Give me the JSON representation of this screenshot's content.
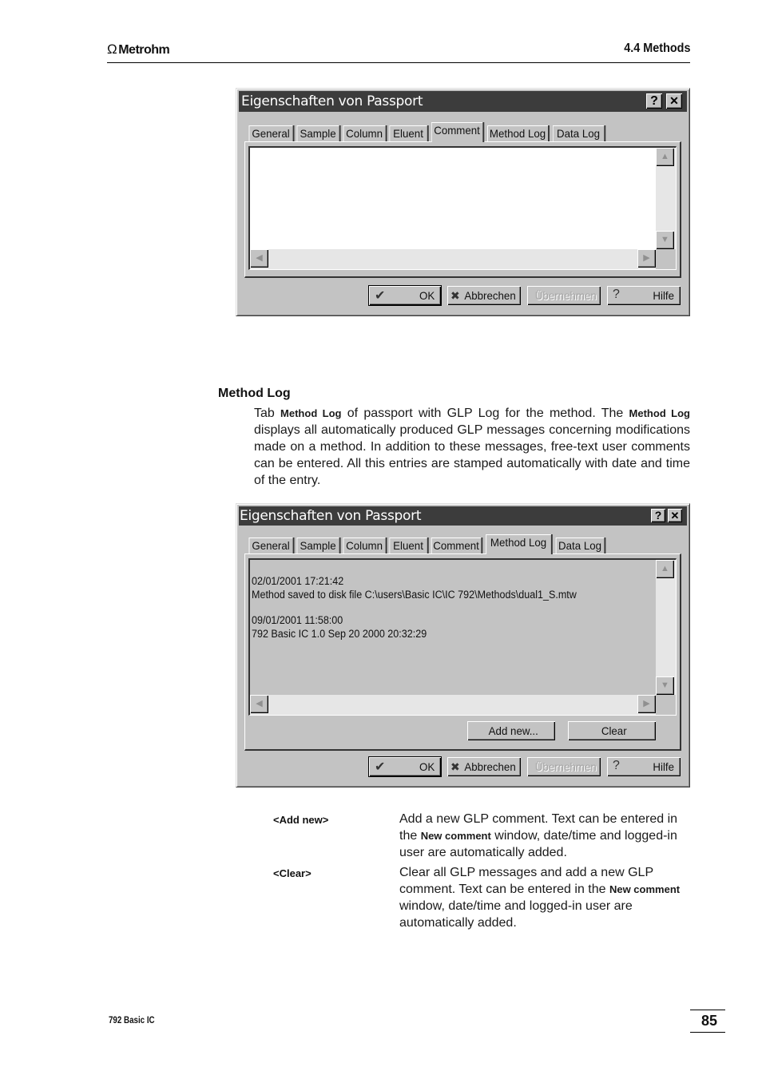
{
  "header": {
    "logo": "Metrohm",
    "logo_symbol": "Ω",
    "section": "4.4  Methods"
  },
  "dialog1": {
    "title": "Eigenschaften von Passport",
    "help_btn": "?",
    "close_btn": "✕",
    "active_tab": "Comment",
    "tabs": [
      "General",
      "Sample",
      "Column",
      "Eluent",
      "Comment",
      "Method Log",
      "Data Log"
    ],
    "comment_text": "",
    "buttons": {
      "ok": "OK",
      "cancel": "Abbrechen",
      "apply": "Übernehmen",
      "help": "Hilfe"
    },
    "icons": {
      "ok": "✔",
      "cancel": "✖",
      "help": "?"
    }
  },
  "method_log_section": {
    "heading": "Method Log",
    "para": [
      {
        "t": "Tab "
      },
      {
        "b": "Method Log"
      },
      {
        "t": " of passport with GLP Log for the method. The "
      },
      {
        "b": "Method Log"
      },
      {
        "t": " displays all automatically produced GLP messages concerning modifications made on a method. In addition to these messages, free-text user comments can be entered. All this entries are stamped automatically with date and time of the entry."
      }
    ]
  },
  "dialog2": {
    "title": "Eigenschaften von Passport",
    "help_btn": "?",
    "close_btn": "✕",
    "active_tab": "Method Log",
    "tabs": [
      "General",
      "Sample",
      "Column",
      "Eluent",
      "Comment",
      "Method Log",
      "Data Log"
    ],
    "log_entries": [
      {
        "timestamp": "02/01/2001 17:21:42",
        "message": "Method saved to disk file C:\\users\\Basic IC\\IC 792\\Methods\\dual1_S.mtw"
      },
      {
        "timestamp": "09/01/2001 11:58:00",
        "message": "792 Basic IC 1.0 Sep 20 2000 20:32:29"
      }
    ],
    "add_new": "Add new...",
    "clear": "Clear",
    "buttons": {
      "ok": "OK",
      "cancel": "Abbrechen",
      "apply": "Übernehmen",
      "help": "Hilfe"
    },
    "icons": {
      "ok": "✔",
      "cancel": "✖",
      "help": "?"
    }
  },
  "definitions": [
    {
      "label": "<Add new>",
      "desc": [
        {
          "t": "Add a new GLP comment. Text can be entered in the "
        },
        {
          "b": "New comment"
        },
        {
          "t": " window, date/time and logged-in user are automatically added."
        }
      ]
    },
    {
      "label": "<Clear>",
      "desc": [
        {
          "t": "Clear all GLP messages and add a new GLP comment. Text can be entered in the "
        },
        {
          "b": "New comment"
        },
        {
          "t": " window, date/time and logged-in user are automatically added."
        }
      ]
    }
  ],
  "footer": {
    "product": "792 Basic IC",
    "page": "85"
  }
}
